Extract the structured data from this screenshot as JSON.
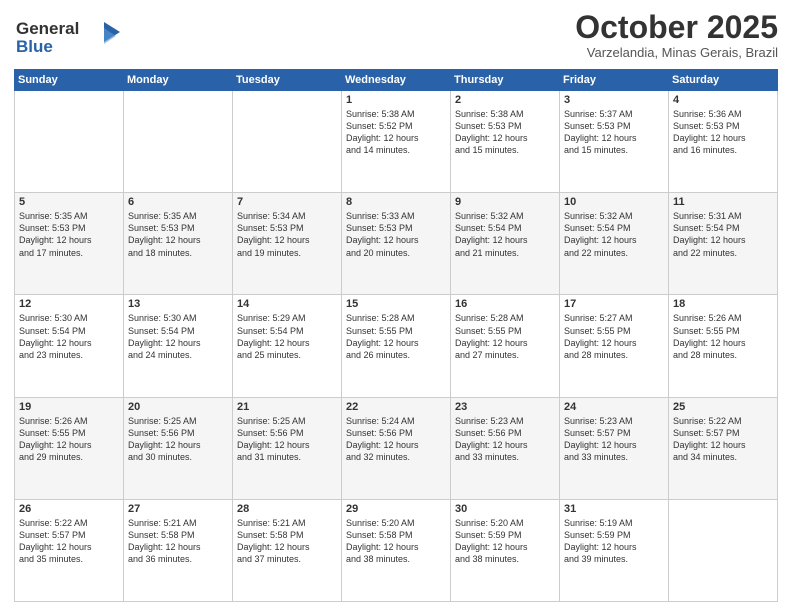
{
  "logo": {
    "line1": "General",
    "line2": "Blue"
  },
  "title": "October 2025",
  "location": "Varzelandia, Minas Gerais, Brazil",
  "days_of_week": [
    "Sunday",
    "Monday",
    "Tuesday",
    "Wednesday",
    "Thursday",
    "Friday",
    "Saturday"
  ],
  "weeks": [
    [
      {
        "day": "",
        "content": ""
      },
      {
        "day": "",
        "content": ""
      },
      {
        "day": "",
        "content": ""
      },
      {
        "day": "1",
        "content": "Sunrise: 5:38 AM\nSunset: 5:52 PM\nDaylight: 12 hours\nand 14 minutes."
      },
      {
        "day": "2",
        "content": "Sunrise: 5:38 AM\nSunset: 5:53 PM\nDaylight: 12 hours\nand 15 minutes."
      },
      {
        "day": "3",
        "content": "Sunrise: 5:37 AM\nSunset: 5:53 PM\nDaylight: 12 hours\nand 15 minutes."
      },
      {
        "day": "4",
        "content": "Sunrise: 5:36 AM\nSunset: 5:53 PM\nDaylight: 12 hours\nand 16 minutes."
      }
    ],
    [
      {
        "day": "5",
        "content": "Sunrise: 5:35 AM\nSunset: 5:53 PM\nDaylight: 12 hours\nand 17 minutes."
      },
      {
        "day": "6",
        "content": "Sunrise: 5:35 AM\nSunset: 5:53 PM\nDaylight: 12 hours\nand 18 minutes."
      },
      {
        "day": "7",
        "content": "Sunrise: 5:34 AM\nSunset: 5:53 PM\nDaylight: 12 hours\nand 19 minutes."
      },
      {
        "day": "8",
        "content": "Sunrise: 5:33 AM\nSunset: 5:53 PM\nDaylight: 12 hours\nand 20 minutes."
      },
      {
        "day": "9",
        "content": "Sunrise: 5:32 AM\nSunset: 5:54 PM\nDaylight: 12 hours\nand 21 minutes."
      },
      {
        "day": "10",
        "content": "Sunrise: 5:32 AM\nSunset: 5:54 PM\nDaylight: 12 hours\nand 22 minutes."
      },
      {
        "day": "11",
        "content": "Sunrise: 5:31 AM\nSunset: 5:54 PM\nDaylight: 12 hours\nand 22 minutes."
      }
    ],
    [
      {
        "day": "12",
        "content": "Sunrise: 5:30 AM\nSunset: 5:54 PM\nDaylight: 12 hours\nand 23 minutes."
      },
      {
        "day": "13",
        "content": "Sunrise: 5:30 AM\nSunset: 5:54 PM\nDaylight: 12 hours\nand 24 minutes."
      },
      {
        "day": "14",
        "content": "Sunrise: 5:29 AM\nSunset: 5:54 PM\nDaylight: 12 hours\nand 25 minutes."
      },
      {
        "day": "15",
        "content": "Sunrise: 5:28 AM\nSunset: 5:55 PM\nDaylight: 12 hours\nand 26 minutes."
      },
      {
        "day": "16",
        "content": "Sunrise: 5:28 AM\nSunset: 5:55 PM\nDaylight: 12 hours\nand 27 minutes."
      },
      {
        "day": "17",
        "content": "Sunrise: 5:27 AM\nSunset: 5:55 PM\nDaylight: 12 hours\nand 28 minutes."
      },
      {
        "day": "18",
        "content": "Sunrise: 5:26 AM\nSunset: 5:55 PM\nDaylight: 12 hours\nand 28 minutes."
      }
    ],
    [
      {
        "day": "19",
        "content": "Sunrise: 5:26 AM\nSunset: 5:55 PM\nDaylight: 12 hours\nand 29 minutes."
      },
      {
        "day": "20",
        "content": "Sunrise: 5:25 AM\nSunset: 5:56 PM\nDaylight: 12 hours\nand 30 minutes."
      },
      {
        "day": "21",
        "content": "Sunrise: 5:25 AM\nSunset: 5:56 PM\nDaylight: 12 hours\nand 31 minutes."
      },
      {
        "day": "22",
        "content": "Sunrise: 5:24 AM\nSunset: 5:56 PM\nDaylight: 12 hours\nand 32 minutes."
      },
      {
        "day": "23",
        "content": "Sunrise: 5:23 AM\nSunset: 5:56 PM\nDaylight: 12 hours\nand 33 minutes."
      },
      {
        "day": "24",
        "content": "Sunrise: 5:23 AM\nSunset: 5:57 PM\nDaylight: 12 hours\nand 33 minutes."
      },
      {
        "day": "25",
        "content": "Sunrise: 5:22 AM\nSunset: 5:57 PM\nDaylight: 12 hours\nand 34 minutes."
      }
    ],
    [
      {
        "day": "26",
        "content": "Sunrise: 5:22 AM\nSunset: 5:57 PM\nDaylight: 12 hours\nand 35 minutes."
      },
      {
        "day": "27",
        "content": "Sunrise: 5:21 AM\nSunset: 5:58 PM\nDaylight: 12 hours\nand 36 minutes."
      },
      {
        "day": "28",
        "content": "Sunrise: 5:21 AM\nSunset: 5:58 PM\nDaylight: 12 hours\nand 37 minutes."
      },
      {
        "day": "29",
        "content": "Sunrise: 5:20 AM\nSunset: 5:58 PM\nDaylight: 12 hours\nand 38 minutes."
      },
      {
        "day": "30",
        "content": "Sunrise: 5:20 AM\nSunset: 5:59 PM\nDaylight: 12 hours\nand 38 minutes."
      },
      {
        "day": "31",
        "content": "Sunrise: 5:19 AM\nSunset: 5:59 PM\nDaylight: 12 hours\nand 39 minutes."
      },
      {
        "day": "",
        "content": ""
      }
    ]
  ]
}
